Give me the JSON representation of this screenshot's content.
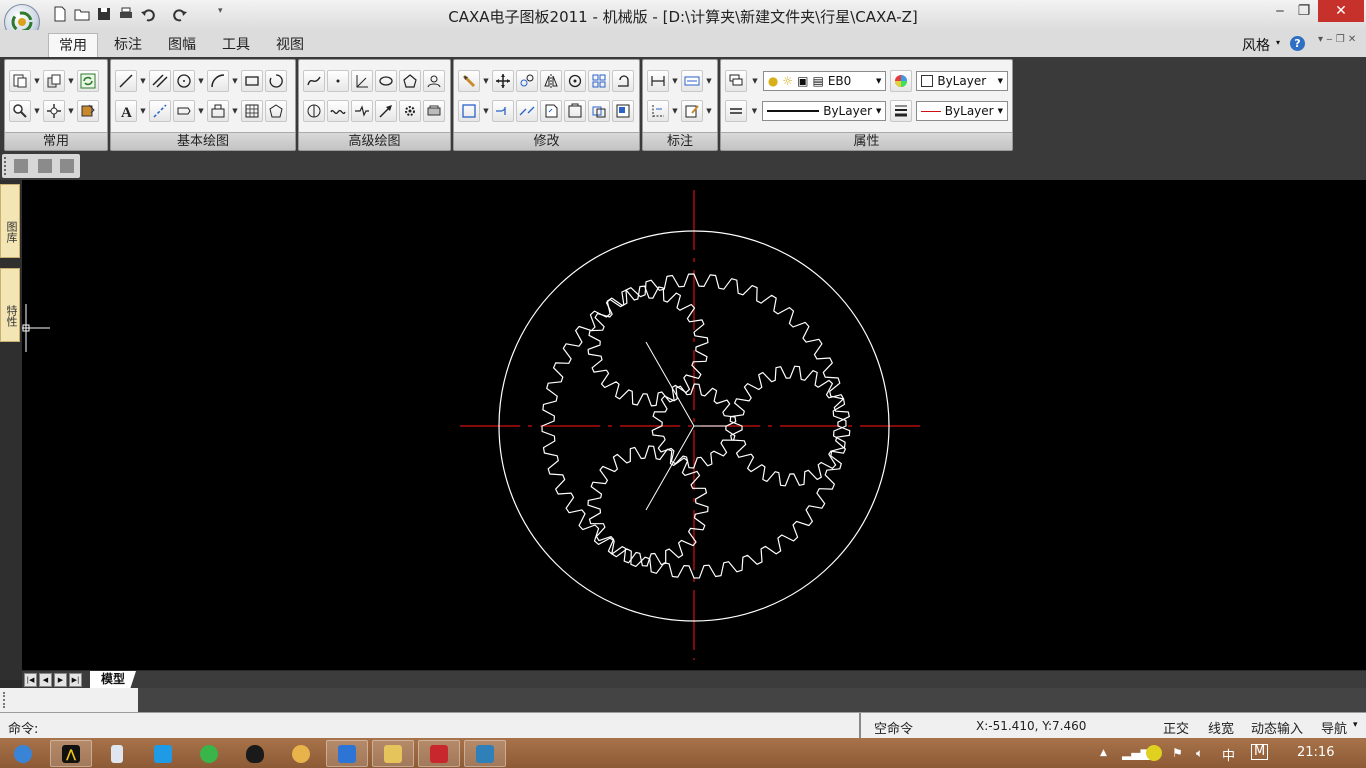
{
  "window": {
    "title": "CAXA电子图板2011 - 机械版 - [D:\\计算夹\\新建文件夹\\行星\\CAXA-Z]",
    "minimize_glyph": "‒",
    "restore_glyph": "❐",
    "close_glyph": "✕"
  },
  "ribbon_tabs": [
    {
      "label": "常用",
      "active": true
    },
    {
      "label": "标注"
    },
    {
      "label": "图幅"
    },
    {
      "label": "工具"
    },
    {
      "label": "视图"
    }
  ],
  "ribbon_right": {
    "style_label": "风格",
    "help": "?"
  },
  "groups": {
    "common": "常用",
    "basic_draw": "基本绘图",
    "advanced_draw": "高级绘图",
    "modify": "修改",
    "dimension": "标注",
    "properties": "属性"
  },
  "properties": {
    "layer_value": "EB0",
    "color_value": "ByLayer",
    "linetype_value": "ByLayer",
    "lineweight_value": "ByLayer"
  },
  "left_dock": {
    "tab1": "图库",
    "tab2": "特性"
  },
  "sheet_tabs": {
    "model": "模型"
  },
  "command": {
    "prompt": "命令:"
  },
  "status": {
    "mode": "空命令",
    "coords": "X:-51.410, Y:7.460",
    "ortho": "正交",
    "lineweight": "线宽",
    "dynamic_input": "动态输入",
    "navigate": "导航"
  },
  "taskbar": {
    "ime": "中",
    "ime_mode": "M",
    "clock": "21:16"
  },
  "colors": {
    "canvas": "#000000",
    "geometry": "#ffffff",
    "centerline": "#d01010",
    "taskbar": "#9a6440"
  }
}
